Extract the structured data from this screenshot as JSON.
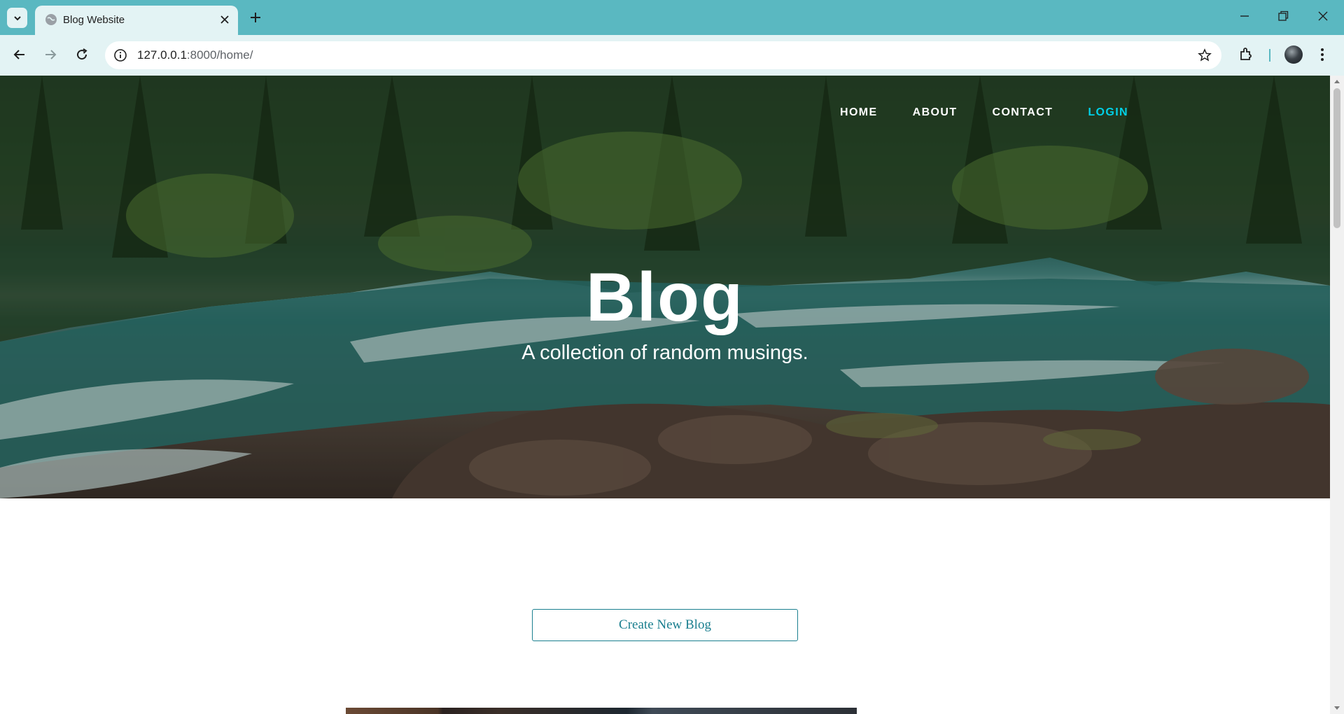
{
  "browser": {
    "tab_title": "Blog Website",
    "url_host": "127.0.0.1",
    "url_path": ":8000/home/"
  },
  "site": {
    "nav": [
      "HOME",
      "ABOUT",
      "CONTACT",
      "LOGIN"
    ],
    "active_nav": "LOGIN",
    "hero_title": "Blog",
    "hero_subtitle": "A collection of random musings.",
    "create_button_label": "Create New Blog",
    "accent_color": "#00d1e8",
    "button_color": "#1b7f8f"
  }
}
